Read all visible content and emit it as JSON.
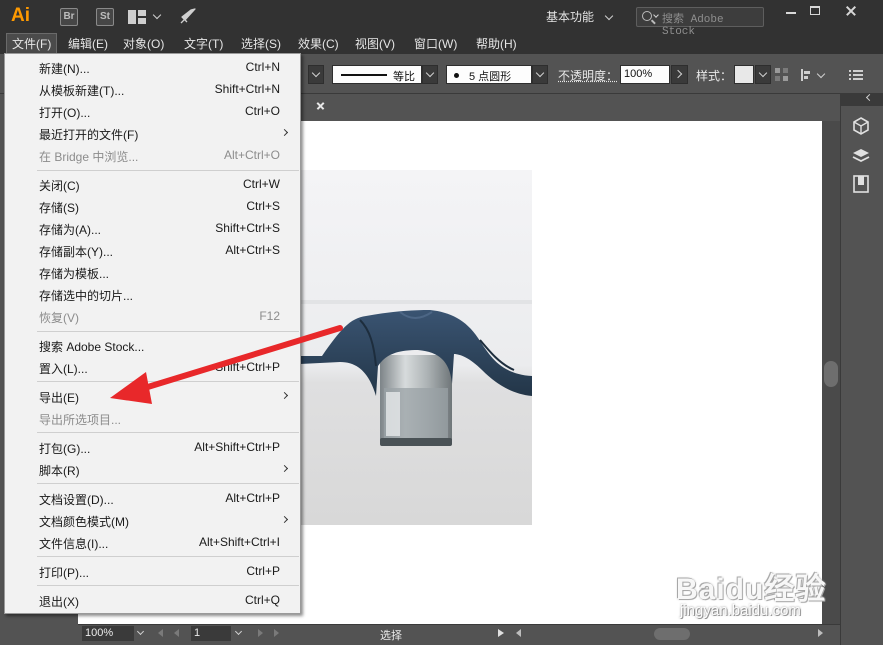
{
  "titlebar": {
    "app_logo": "Ai",
    "bridge_badge": "Br",
    "stock_badge": "St",
    "workspace_label": "基本功能",
    "search_placeholder": "搜索 Adobe Stock"
  },
  "menubar": {
    "items": [
      {
        "label": "文件(F)"
      },
      {
        "label": "编辑(E)"
      },
      {
        "label": "对象(O)"
      },
      {
        "label": "文字(T)"
      },
      {
        "label": "选择(S)"
      },
      {
        "label": "效果(C)"
      },
      {
        "label": "视图(V)"
      },
      {
        "label": "窗口(W)"
      },
      {
        "label": "帮助(H)"
      }
    ]
  },
  "controlbar": {
    "stroke_profile": "等比",
    "brush": "5 点圆形",
    "opacity_label": "不透明度：",
    "opacity_value": "100%",
    "style_label": "样式："
  },
  "file_menu": {
    "items": [
      {
        "label": "新建(N)...",
        "shortcut": "Ctrl+N"
      },
      {
        "label": "从模板新建(T)...",
        "shortcut": "Shift+Ctrl+N"
      },
      {
        "label": "打开(O)...",
        "shortcut": "Ctrl+O"
      },
      {
        "label": "最近打开的文件(F)",
        "shortcut": ""
      },
      {
        "label": "在 Bridge 中浏览...",
        "shortcut": "Alt+Ctrl+O"
      },
      {
        "label": "关闭(C)",
        "shortcut": "Ctrl+W"
      },
      {
        "label": "存储(S)",
        "shortcut": "Ctrl+S"
      },
      {
        "label": "存储为(A)...",
        "shortcut": "Shift+Ctrl+S"
      },
      {
        "label": "存储副本(Y)...",
        "shortcut": "Alt+Ctrl+S"
      },
      {
        "label": "存储为模板...",
        "shortcut": ""
      },
      {
        "label": "存储选中的切片...",
        "shortcut": ""
      },
      {
        "label": "恢复(V)",
        "shortcut": "F12"
      },
      {
        "label": "搜索 Adobe Stock...",
        "shortcut": ""
      },
      {
        "label": "置入(L)...",
        "shortcut": "Shift+Ctrl+P"
      },
      {
        "label": "导出(E)",
        "shortcut": ""
      },
      {
        "label": "导出所选项目...",
        "shortcut": ""
      },
      {
        "label": "打包(G)...",
        "shortcut": "Alt+Shift+Ctrl+P"
      },
      {
        "label": "脚本(R)",
        "shortcut": ""
      },
      {
        "label": "文档设置(D)...",
        "shortcut": "Alt+Ctrl+P"
      },
      {
        "label": "文档颜色模式(M)",
        "shortcut": ""
      },
      {
        "label": "文件信息(I)...",
        "shortcut": "Alt+Shift+Ctrl+I"
      },
      {
        "label": "打印(P)...",
        "shortcut": "Ctrl+P"
      },
      {
        "label": "退出(X)",
        "shortcut": "Ctrl+Q"
      }
    ]
  },
  "statusbar": {
    "zoom": "100%",
    "page": "1",
    "status": "选择"
  },
  "watermark": {
    "main": "Baidu经验",
    "sub": "jingyan.baidu.com"
  },
  "colors": {
    "app_chrome": "#323232",
    "workspace_bg": "#535353",
    "menu_bg": "#f2f2f2",
    "ai_orange": "#ff9a00",
    "annotation_red": "#e8282a",
    "fabric_navy": "#2e4560"
  }
}
